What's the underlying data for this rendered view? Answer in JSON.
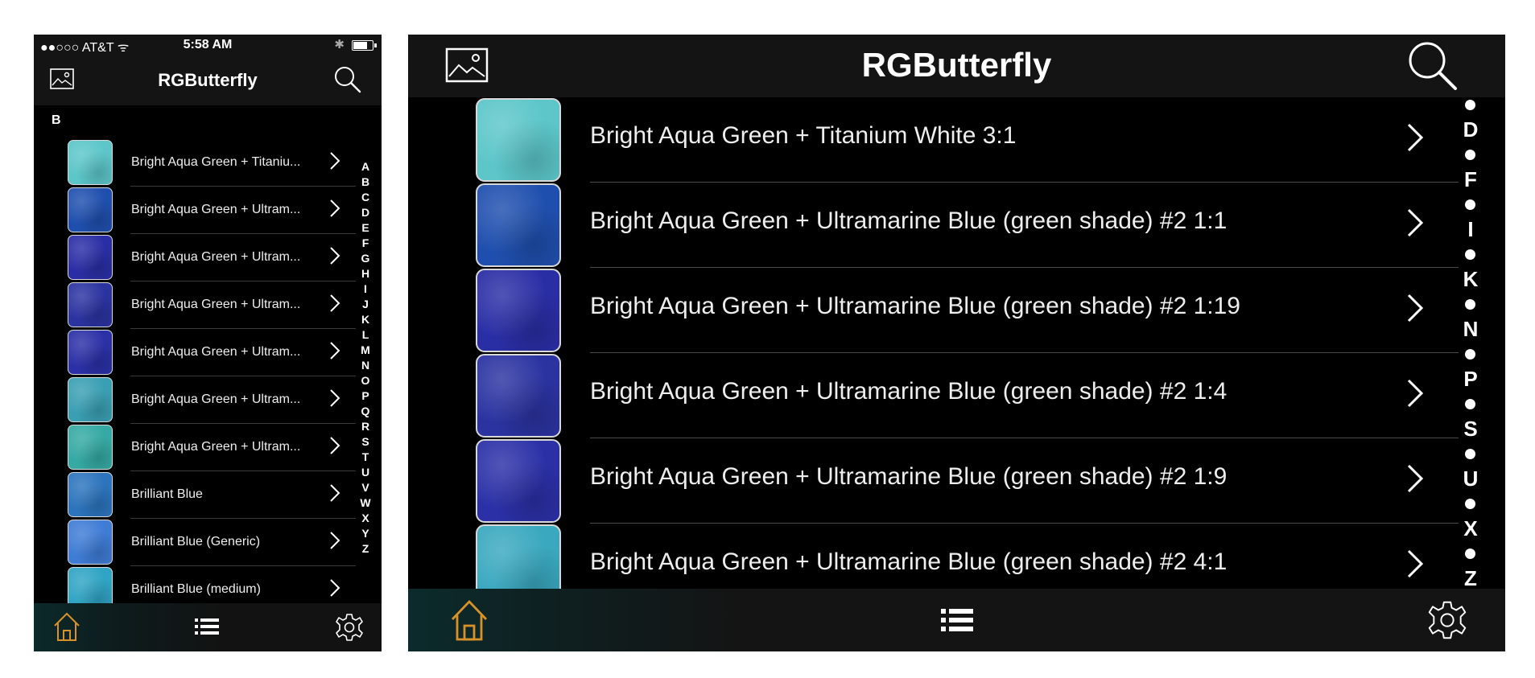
{
  "colors": {
    "accent": "#d9922a",
    "background": "#000000",
    "bar": "#141414"
  },
  "status_bar": {
    "carrier": "●●○○○ AT&T ᯤ",
    "time": "5:58 AM",
    "bluetooth": "✱"
  },
  "app": {
    "title": "RGButterfly"
  },
  "phone": {
    "section_header": "B",
    "rows": [
      {
        "label": "Bright Aqua Green + Titaniu...",
        "swatch": "#5cc6c9"
      },
      {
        "label": "Bright Aqua Green + Ultram...",
        "swatch": "#1f4fae"
      },
      {
        "label": "Bright Aqua Green + Ultram...",
        "swatch": "#2a2ea5"
      },
      {
        "label": "Bright Aqua Green + Ultram...",
        "swatch": "#2b33a1"
      },
      {
        "label": "Bright Aqua Green + Ultram...",
        "swatch": "#2b30a7"
      },
      {
        "label": "Bright Aqua Green + Ultram...",
        "swatch": "#3a9fb3"
      },
      {
        "label": "Bright Aqua Green + Ultram...",
        "swatch": "#35a9a3"
      },
      {
        "label": "Brilliant Blue",
        "swatch": "#2c74bd"
      },
      {
        "label": "Brilliant Blue (Generic)",
        "swatch": "#3f7cd6"
      },
      {
        "label": "Brilliant Blue (medium)",
        "swatch": "#2fa4c4"
      }
    ],
    "index_letters": [
      "A",
      "B",
      "C",
      "D",
      "E",
      "F",
      "G",
      "H",
      "I",
      "J",
      "K",
      "L",
      "M",
      "N",
      "O",
      "P",
      "Q",
      "R",
      "S",
      "T",
      "U",
      "V",
      "W",
      "X",
      "Y",
      "Z"
    ]
  },
  "tablet": {
    "rows": [
      {
        "label": "Bright Aqua Green + Titanium White 3:1",
        "swatch": "#5cc6c9"
      },
      {
        "label": "Bright Aqua Green + Ultramarine Blue (green shade) #2 1:1",
        "swatch": "#1f4fae"
      },
      {
        "label": "Bright Aqua Green + Ultramarine Blue (green shade) #2 1:19",
        "swatch": "#2a2ea5"
      },
      {
        "label": "Bright Aqua Green + Ultramarine Blue (green shade) #2 1:4",
        "swatch": "#2b33a1"
      },
      {
        "label": "Bright Aqua Green + Ultramarine Blue (green shade) #2 1:9",
        "swatch": "#2b30a7"
      },
      {
        "label": "Bright Aqua Green + Ultramarine Blue (green shade) #2 4:1",
        "swatch": "#3aa8bf"
      }
    ],
    "index": [
      "•",
      "D",
      "•",
      "F",
      "•",
      "I",
      "•",
      "K",
      "•",
      "N",
      "•",
      "P",
      "•",
      "S",
      "•",
      "U",
      "•",
      "X",
      "•",
      "Z"
    ]
  },
  "tab_bar": {
    "items": [
      "home-icon",
      "list-icon",
      "gear-icon"
    ],
    "selected": "home-icon"
  }
}
